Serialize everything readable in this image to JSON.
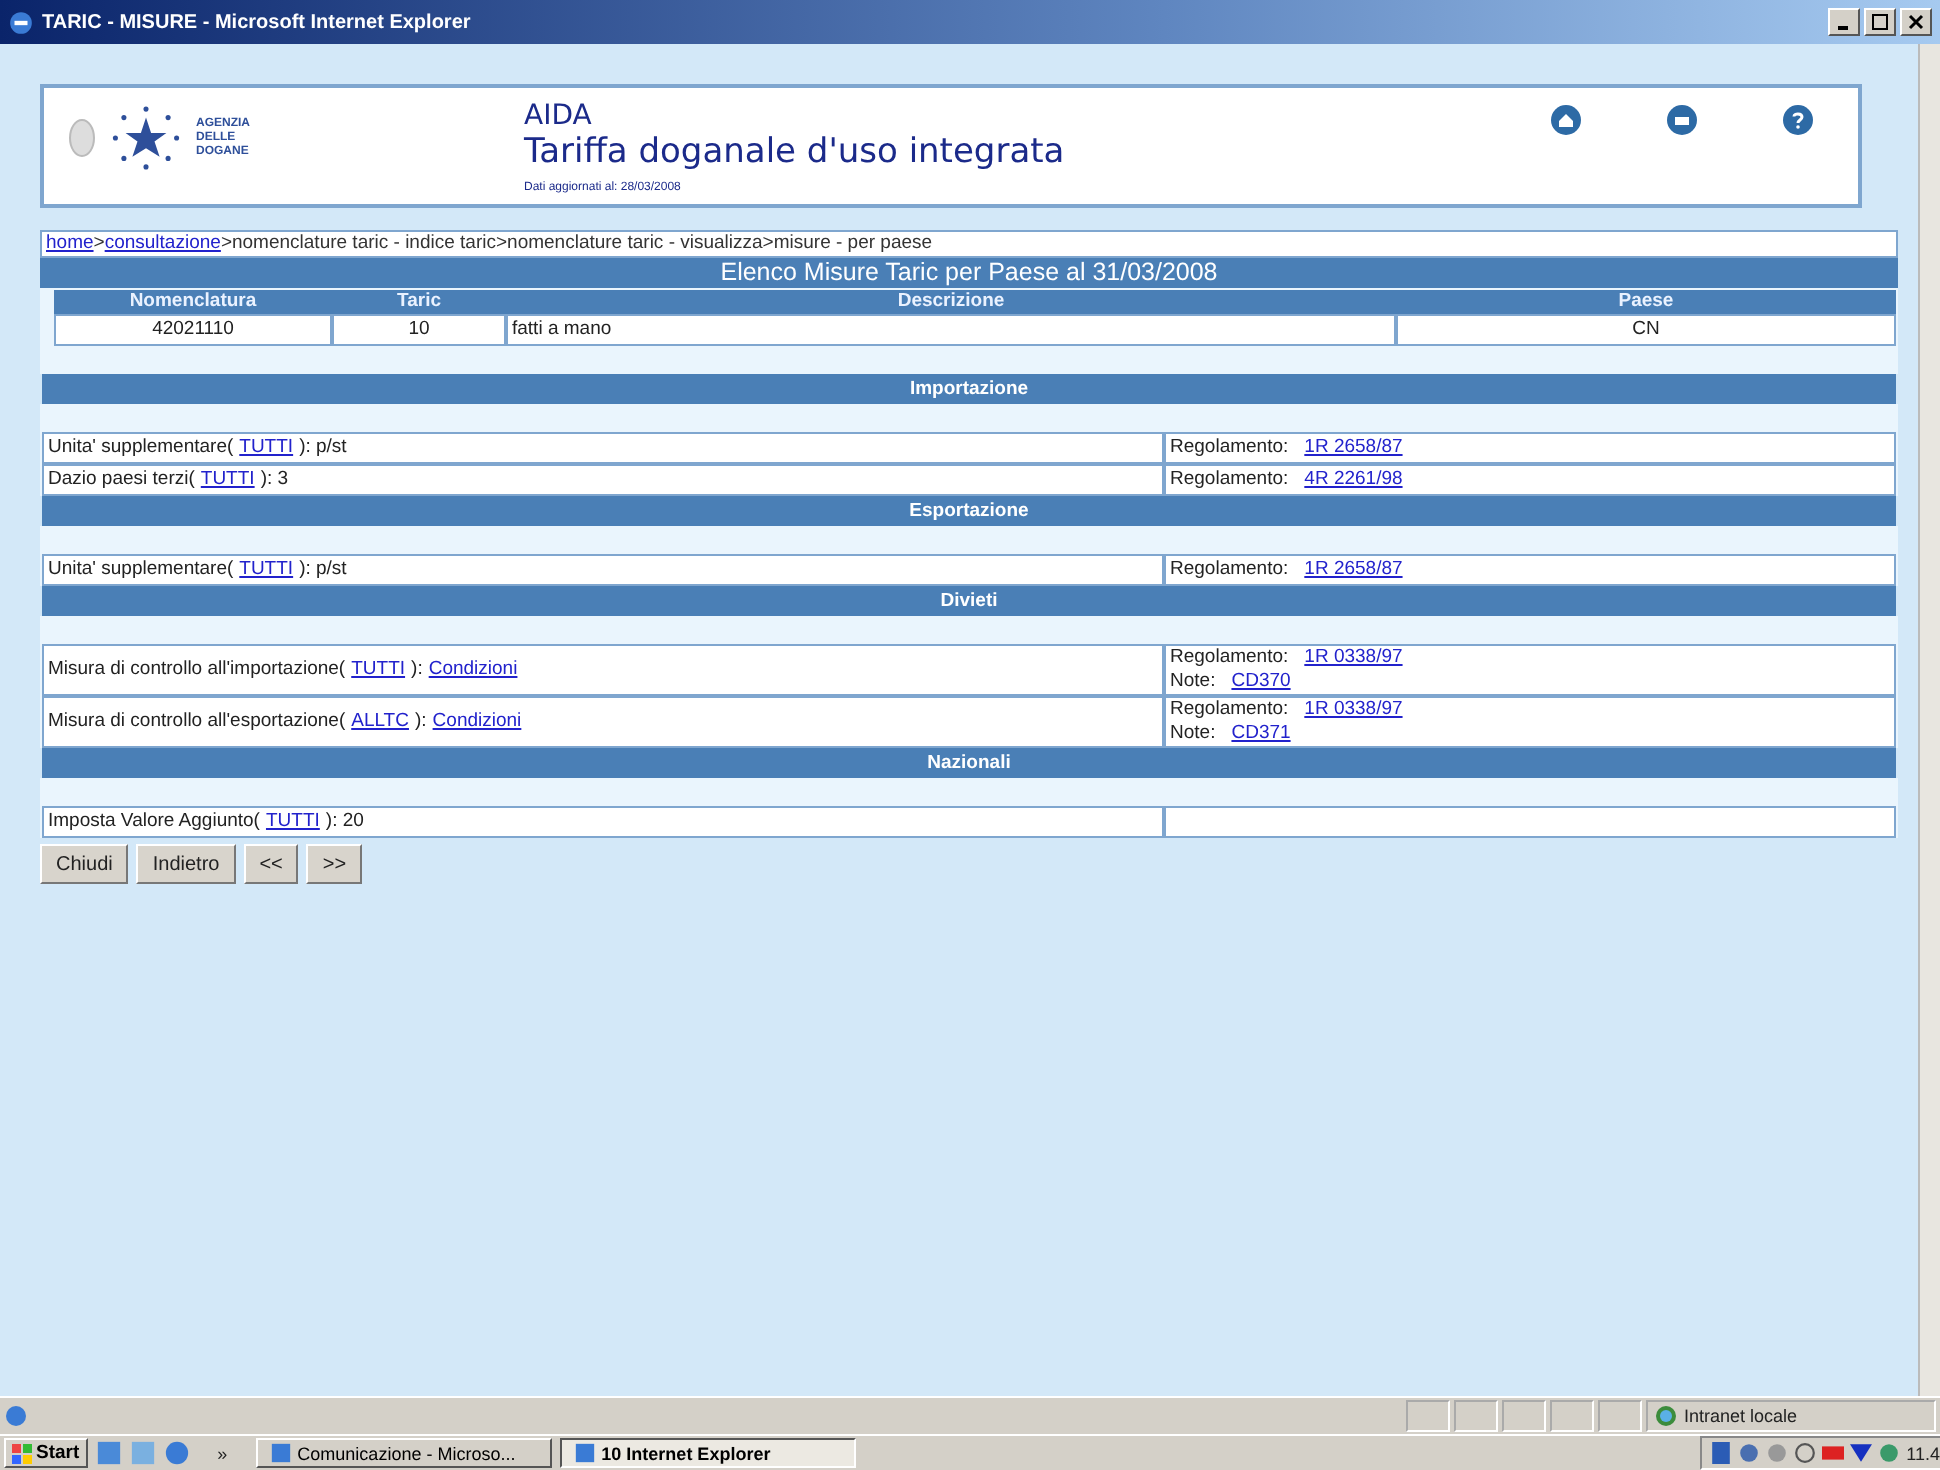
{
  "window": {
    "title": "TARIC - MISURE - Microsoft Internet Explorer"
  },
  "header": {
    "logo_text": "AGENZIA DELLE DOGANE",
    "app_name": "AIDA",
    "subtitle": "Tariffa doganale d'uso integrata",
    "updated": "Dati aggiornati al: 28/03/2008"
  },
  "breadcrumb": [
    {
      "text": "home",
      "link": true
    },
    {
      "text": ">",
      "link": false
    },
    {
      "text": "consultazione",
      "link": true
    },
    {
      "text": ">nomenclature taric - indice taric>nomenclature taric - visualizza>misure - per paese",
      "link": false
    }
  ],
  "heading": "Elenco Misure Taric per Paese al 31/03/2008",
  "summary": {
    "columns": [
      "Nomenclatura",
      "Taric",
      "Descrizione",
      "Paese"
    ],
    "row": [
      "42021110",
      "10",
      "fatti a mano",
      "CN"
    ]
  },
  "sections": [
    {
      "title": "Importazione",
      "rows": [
        {
          "left": [
            {
              "text": "Unita' supplementare(",
              "link": false
            },
            {
              "text": "TUTTI",
              "link": true
            },
            {
              "text": "): p/st",
              "link": false
            }
          ],
          "right": [
            [
              {
                "text": "Regolamento:",
                "link": false
              },
              {
                "text": "1R 2658/87",
                "link": true
              }
            ]
          ]
        },
        {
          "left": [
            {
              "text": "Dazio paesi terzi(",
              "link": false
            },
            {
              "text": "TUTTI",
              "link": true
            },
            {
              "text": "): 3",
              "link": false
            }
          ],
          "right": [
            [
              {
                "text": "Regolamento:",
                "link": false
              },
              {
                "text": "4R 2261/98",
                "link": true
              }
            ]
          ]
        }
      ]
    },
    {
      "title": "Esportazione",
      "rows": [
        {
          "left": [
            {
              "text": "Unita' supplementare(",
              "link": false
            },
            {
              "text": "TUTTI",
              "link": true
            },
            {
              "text": "): p/st",
              "link": false
            }
          ],
          "right": [
            [
              {
                "text": "Regolamento:",
                "link": false
              },
              {
                "text": "1R 2658/87",
                "link": true
              }
            ]
          ]
        }
      ]
    },
    {
      "title": "Divieti",
      "rows": [
        {
          "left": [
            {
              "text": "Misura di controllo all'importazione(",
              "link": false
            },
            {
              "text": "TUTTI",
              "link": true
            },
            {
              "text": "):",
              "link": false
            },
            {
              "text": "Condizioni",
              "link": true
            }
          ],
          "right": [
            [
              {
                "text": "Regolamento:",
                "link": false
              },
              {
                "text": "1R 0338/97",
                "link": true
              }
            ],
            [
              {
                "text": "Note:",
                "link": false
              },
              {
                "text": "CD370",
                "link": true
              }
            ]
          ]
        },
        {
          "left": [
            {
              "text": "Misura di controllo all'esportazione(",
              "link": false
            },
            {
              "text": "ALLTC",
              "link": true
            },
            {
              "text": "):",
              "link": false
            },
            {
              "text": "Condizioni",
              "link": true
            }
          ],
          "right": [
            [
              {
                "text": "Regolamento:",
                "link": false
              },
              {
                "text": "1R 0338/97",
                "link": true
              }
            ],
            [
              {
                "text": "Note:",
                "link": false
              },
              {
                "text": "CD371",
                "link": true
              }
            ]
          ]
        }
      ]
    },
    {
      "title": "Nazionali",
      "rows": [
        {
          "left": [
            {
              "text": "Imposta Valore Aggiunto(",
              "link": false
            },
            {
              "text": "TUTTI",
              "link": true
            },
            {
              "text": "): 20",
              "link": false
            }
          ],
          "right": []
        }
      ]
    }
  ],
  "buttons": [
    "Chiudi",
    "Indietro",
    "<<",
    ">>"
  ],
  "status_bar": {
    "zone": "Intranet locale"
  },
  "taskbar": {
    "start": "Start",
    "chevron": "»",
    "tasks": [
      {
        "label": "Comunicazione - Microso...",
        "selected": false
      },
      {
        "label": "10 Internet Explorer",
        "selected": true
      }
    ],
    "clock": "11.4"
  }
}
